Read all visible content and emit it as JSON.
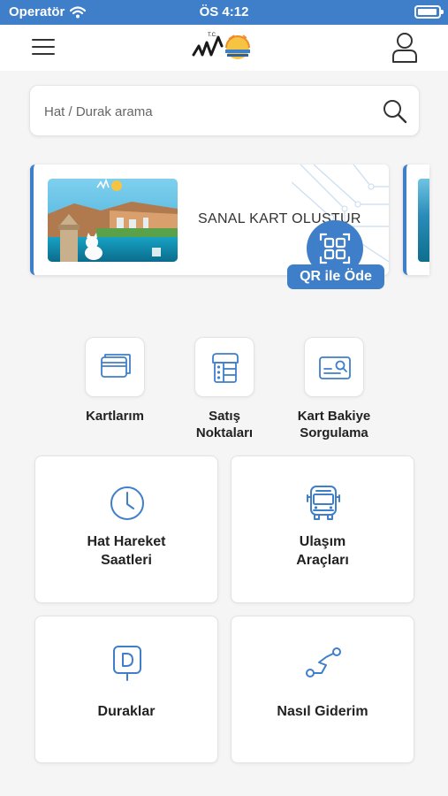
{
  "status_bar": {
    "carrier": "Operatör",
    "time": "ÖS 4:12"
  },
  "header": {
    "logo_text": "T.C."
  },
  "search": {
    "placeholder": "Hat / Durak arama"
  },
  "carousel": {
    "card_title": "SANAL KART OLUŞTUR",
    "qr_button_label": "QR ile Öde"
  },
  "quick_actions": [
    {
      "line1": "Kartlarım",
      "line2": ""
    },
    {
      "line1": "Satış",
      "line2": "Noktaları"
    },
    {
      "line1": "Kart Bakiye",
      "line2": "Sorgulama"
    }
  ],
  "tiles": [
    {
      "line1": "Hat Hareket",
      "line2": "Saatleri"
    },
    {
      "line1": "Ulaşım",
      "line2": "Araçları"
    },
    {
      "line1": "Duraklar",
      "line2": ""
    },
    {
      "line1": "Nasıl Giderim",
      "line2": ""
    }
  ],
  "colors": {
    "primary": "#3f7fc9",
    "background": "#f5f5f5",
    "text": "#222222"
  },
  "icons": {
    "wifi": "wifi-icon",
    "battery": "battery-icon",
    "menu": "hamburger-menu-icon",
    "profile": "user-profile-icon",
    "search": "search-icon",
    "qr": "qr-code-icon",
    "cards": "cards-icon",
    "sales_points": "store-icon",
    "balance": "card-search-icon",
    "schedule": "clock-icon",
    "vehicles": "bus-icon",
    "stops": "bus-stop-sign-icon",
    "route": "route-icon"
  }
}
